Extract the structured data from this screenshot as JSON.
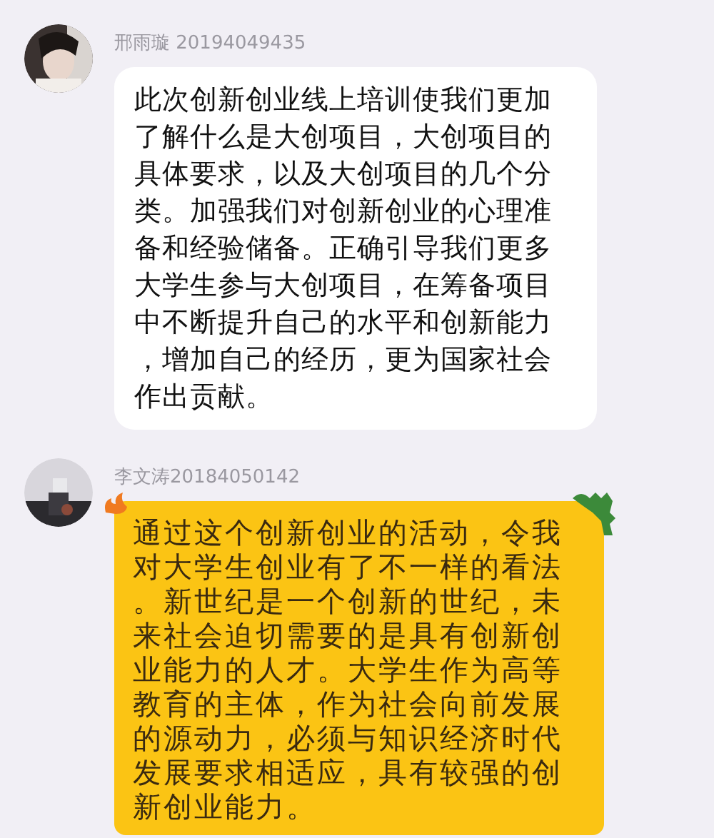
{
  "messages": [
    {
      "sender": "邢雨璇 20194049435",
      "text": "此次创新创业线上培训使我们更加了解什么是大创项目，大创项目的具体要求，以及大创项目的几个分类。加强我们对创新创业的心理准备和经验储备。正确引导我们更多大学生参与大创项目，在筹备项目中不断提升自己的水平和创新能力，增加自己的经历，更为国家社会作出贡献。",
      "kind": "plain"
    },
    {
      "sender": "李文涛20184050142",
      "text": "通过这个创新创业的活动，令我对大学生创业有了不一样的看法。新世纪是一个创新的世纪，未来社会迫切需要的是具有创新创业能力的人才。大学生作为高等教育的主体，作为社会向前发展的源动力，必须与知识经济时代发展要求相适应，具有较强的创新创业能力。",
      "kind": "sticker"
    }
  ]
}
